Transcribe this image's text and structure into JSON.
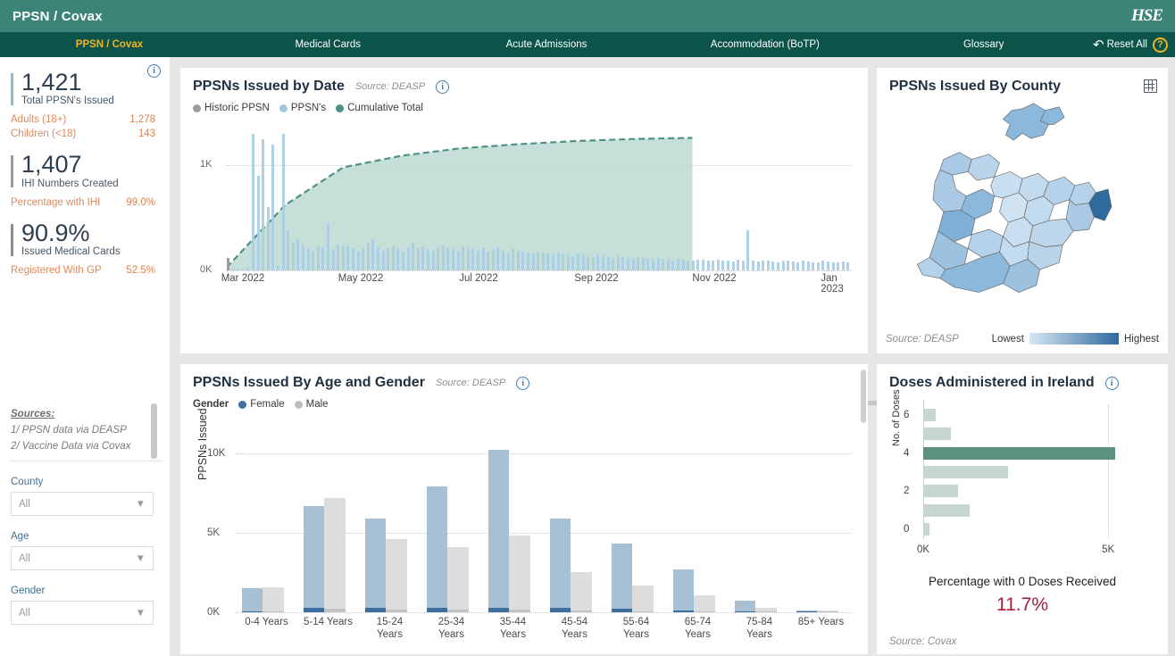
{
  "header": {
    "title": "PPSN / Covax",
    "logo": "hse-logo",
    "reset_label": "Reset All",
    "help_label": "?"
  },
  "nav": {
    "tabs": [
      {
        "label": "PPSN / Covax",
        "active": true
      },
      {
        "label": "Medical Cards",
        "active": false
      },
      {
        "label": "Acute Admissions",
        "active": false
      },
      {
        "label": "Accommodation (BoTP)",
        "active": false
      },
      {
        "label": "Glossary",
        "active": false
      }
    ]
  },
  "sidebar": {
    "kpis": [
      {
        "value": "1,421",
        "label": "Total PPSN's Issued"
      },
      {
        "value": "1,407",
        "label": "IHI Numbers Created"
      },
      {
        "value": "90.9%",
        "label": "Issued Medical Cards"
      }
    ],
    "rows_group1": [
      {
        "label": "Adults (18+)",
        "value": "1,278"
      },
      {
        "label": "Children (<18)",
        "value": "143"
      }
    ],
    "rows_group2": [
      {
        "label": "Percentage with IHI",
        "value": "99.0%"
      }
    ],
    "rows_group3": [
      {
        "label": "Registered With GP",
        "value": "52.5%"
      }
    ],
    "sources_title": "Sources:",
    "sources_line1": "1/ PPSN data via DEASP",
    "sources_line2": "2/ Vaccine Data via Covax",
    "filters": [
      {
        "label": "County",
        "value": "All"
      },
      {
        "label": "Age",
        "value": "All"
      },
      {
        "label": "Gender",
        "value": "All"
      }
    ]
  },
  "panels": {
    "date": {
      "title": "PPSNs Issued by Date",
      "source": "Source: DEASP",
      "legend": [
        {
          "label": "Historic PPSN",
          "color": "#9e9e9e"
        },
        {
          "label": "PPSN's",
          "color": "#9ec9e0"
        },
        {
          "label": "Cumulative Total",
          "color": "#4f9184"
        }
      ],
      "range_start": "3/1/2022",
      "range_end": "1/31/2023"
    },
    "map": {
      "title": "PPSNs Issued By County",
      "source": "Source: DEASP",
      "legend_low": "Lowest",
      "legend_high": "Highest"
    },
    "age": {
      "title": "PPSNs Issued By Age and Gender",
      "source": "Source: DEASP",
      "legend_title": "Gender",
      "legend": [
        {
          "label": "Female",
          "color": "#3d6e9e"
        },
        {
          "label": "Male",
          "color": "#bdbdbd"
        }
      ]
    },
    "doses": {
      "title": "Doses Administered in Ireland",
      "pct_label": "Percentage with 0 Doses Received",
      "pct_value": "11.7%",
      "source": "Source: Covax"
    }
  },
  "chart_data": [
    {
      "id": "ppsn_by_date",
      "type": "area",
      "title": "PPSNs Issued by Date",
      "xlabel": "",
      "ylabel": "",
      "ylim": [
        0,
        1400
      ],
      "yticks": [
        "0K",
        "1K"
      ],
      "ytick_values": [
        0,
        1000
      ],
      "xticks": [
        "Mar 2022",
        "May 2022",
        "Jul 2022",
        "Sep 2022",
        "Nov 2022",
        "Jan 2023"
      ],
      "grid": true,
      "legend_position": "top-left",
      "series": [
        {
          "name": "Cumulative Total",
          "type": "area-dashed-line",
          "color": "#4f9184",
          "note": "Rises steeply Mar-May 2022 then plateaus near 1250; shaded region ends Nov 2022",
          "x": [
            "Mar 2022",
            "Apr 2022",
            "May 2022",
            "Jun 2022",
            "Jul 2022",
            "Aug 2022",
            "Sep 2022",
            "Oct 2022",
            "Nov 2022"
          ],
          "values": [
            30,
            620,
            980,
            1090,
            1160,
            1200,
            1230,
            1250,
            1260
          ]
        },
        {
          "name": "PPSN's",
          "type": "bar",
          "color": "#9ec9e0",
          "note": "Daily issuance spikes; largest spikes in Mar-Apr 2022 reaching ~1300",
          "values": [
            60,
            10,
            15,
            20,
            30,
            1300,
            900,
            1250,
            600,
            1200,
            40,
            1300,
            380,
            260,
            300,
            240,
            200,
            190,
            230,
            220,
            450,
            200,
            250,
            230,
            240,
            210,
            180,
            200,
            260,
            300,
            220,
            190,
            210,
            240,
            200,
            180,
            220,
            260,
            210,
            230,
            200,
            190,
            220,
            240,
            210,
            200,
            180,
            230,
            220,
            200,
            190,
            210,
            180,
            200,
            220,
            190,
            170,
            200,
            190,
            180,
            170,
            160,
            180,
            170,
            160,
            150,
            170,
            160,
            150,
            140,
            160,
            150,
            140,
            130,
            150,
            140,
            130,
            120,
            140,
            130,
            120,
            110,
            130,
            120,
            110,
            100,
            120,
            110,
            100,
            95,
            110,
            100,
            95,
            90,
            105,
            100,
            95,
            90,
            100,
            95,
            90,
            85,
            100,
            95,
            380,
            90,
            85,
            95,
            90,
            85,
            80,
            95,
            90,
            85,
            80,
            90,
            85,
            80,
            75,
            90,
            85,
            80,
            75,
            85,
            80
          ]
        },
        {
          "name": "Historic PPSN",
          "type": "bar",
          "color": "#9e9e9e",
          "note": "Single small grey bar at the very start of the series",
          "values": [
            120
          ]
        }
      ]
    },
    {
      "id": "ppsn_by_county",
      "type": "heatmap",
      "title": "PPSNs Issued By County",
      "note": "Choropleth of Ireland; Dublin is darkest (highest)",
      "legend": [
        "Lowest",
        "Highest"
      ],
      "colors": [
        "#d6e6f4",
        "#2f6a9e"
      ],
      "highlight_region": "Dublin"
    },
    {
      "id": "ppsn_by_age_gender",
      "type": "bar",
      "title": "PPSNs Issued By Age and Gender",
      "xlabel": "",
      "ylabel": "PPSNs Issued",
      "ylim": [
        0,
        11000
      ],
      "yticks": [
        "0K",
        "5K",
        "10K"
      ],
      "ytick_values": [
        0,
        5000,
        10000
      ],
      "grid": true,
      "legend_position": "top-left",
      "categories": [
        "0-4 Years",
        "5-14 Years",
        "15-24 Years",
        "25-34 Years",
        "35-44 Years",
        "45-54 Years",
        "55-64 Years",
        "65-74 Years",
        "75-84 Years",
        "85+ Years"
      ],
      "series": [
        {
          "name": "Female",
          "color": "#a8c0d4",
          "values": [
            1500,
            6700,
            5900,
            7900,
            10200,
            5900,
            4300,
            2700,
            750,
            120
          ]
        },
        {
          "name": "Male",
          "color": "#dddddd",
          "values": [
            1550,
            7200,
            4600,
            4100,
            4800,
            2500,
            1700,
            1050,
            260,
            90
          ]
        }
      ]
    },
    {
      "id": "doses_administered",
      "type": "bar",
      "orientation": "horizontal",
      "title": "Doses Administered in Ireland",
      "xlabel": "",
      "ylabel": "No. of Doses",
      "xlim": [
        0,
        5600
      ],
      "xticks": [
        "0K",
        "5K"
      ],
      "xtick_values": [
        0,
        5000
      ],
      "grid": true,
      "categories": [
        "0",
        "1",
        "2",
        "3",
        "4",
        "5",
        "6"
      ],
      "values": [
        180,
        1250,
        950,
        2300,
        5200,
        760,
        330
      ],
      "highlight_category": "4",
      "colors": {
        "bar": "#c4d6cf",
        "highlight": "#5d917f"
      },
      "annotation_label": "Percentage with 0 Doses Received",
      "annotation_value": "11.7%"
    }
  ]
}
